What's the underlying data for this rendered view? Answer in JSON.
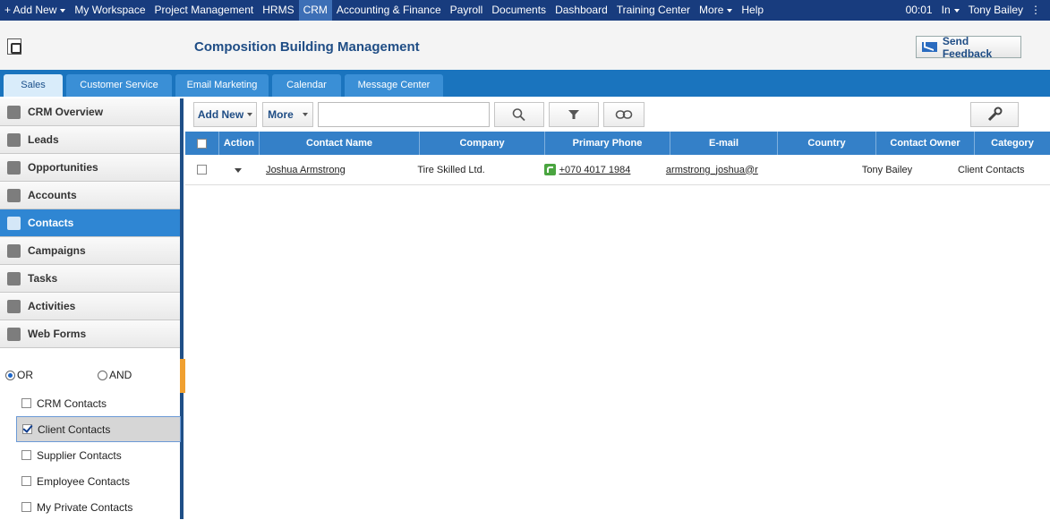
{
  "topnav": {
    "items": [
      "+ Add New",
      "My Workspace",
      "Project Management",
      "HRMS",
      "CRM",
      "Accounting & Finance",
      "Payroll",
      "Documents",
      "Dashboard",
      "Training Center",
      "More",
      "Help"
    ],
    "time": "00:01",
    "status": "In",
    "user": "Tony Bailey"
  },
  "header": {
    "title": "Composition Building Management",
    "feedback": "Send Feedback"
  },
  "tabs": [
    "Sales",
    "Customer Service",
    "Email Marketing",
    "Calendar",
    "Message Center"
  ],
  "sidebar": {
    "items": [
      {
        "label": "CRM Overview",
        "icon": "crm-overview-icon"
      },
      {
        "label": "Leads",
        "icon": "leads-icon"
      },
      {
        "label": "Opportunities",
        "icon": "opportunities-icon"
      },
      {
        "label": "Accounts",
        "icon": "accounts-icon"
      },
      {
        "label": "Contacts",
        "icon": "contacts-icon"
      },
      {
        "label": "Campaigns",
        "icon": "campaigns-icon"
      },
      {
        "label": "Tasks",
        "icon": "tasks-icon"
      },
      {
        "label": "Activities",
        "icon": "activities-icon"
      },
      {
        "label": "Web Forms",
        "icon": "web-forms-icon"
      }
    ],
    "active": "Contacts",
    "logic": {
      "or": "OR",
      "and": "AND",
      "selected": "OR"
    },
    "filters": [
      {
        "label": "CRM Contacts",
        "checked": false
      },
      {
        "label": "Client Contacts",
        "checked": true
      },
      {
        "label": "Supplier Contacts",
        "checked": false
      },
      {
        "label": "Employee Contacts",
        "checked": false
      },
      {
        "label": "My Private Contacts",
        "checked": false
      }
    ]
  },
  "toolbar": {
    "add_new": "Add New",
    "more": "More",
    "search_value": ""
  },
  "grid": {
    "columns": [
      "",
      "Action",
      "Contact Name",
      "Company",
      "Primary Phone",
      "E-mail",
      "Country",
      "Contact Owner",
      "Category"
    ],
    "rows": [
      {
        "contact_name": "Joshua Armstrong",
        "company": "Tire Skilled Ltd.",
        "phone": "+070 4017 1984",
        "email": "armstrong_joshua@r",
        "country": "",
        "owner": "Tony Bailey",
        "category": "Client Contacts"
      }
    ]
  },
  "colors": {
    "topbar": "#183c7e",
    "tabbar": "#1a74be",
    "grid_header": "#3480c8",
    "active_item": "#2f86d3"
  }
}
